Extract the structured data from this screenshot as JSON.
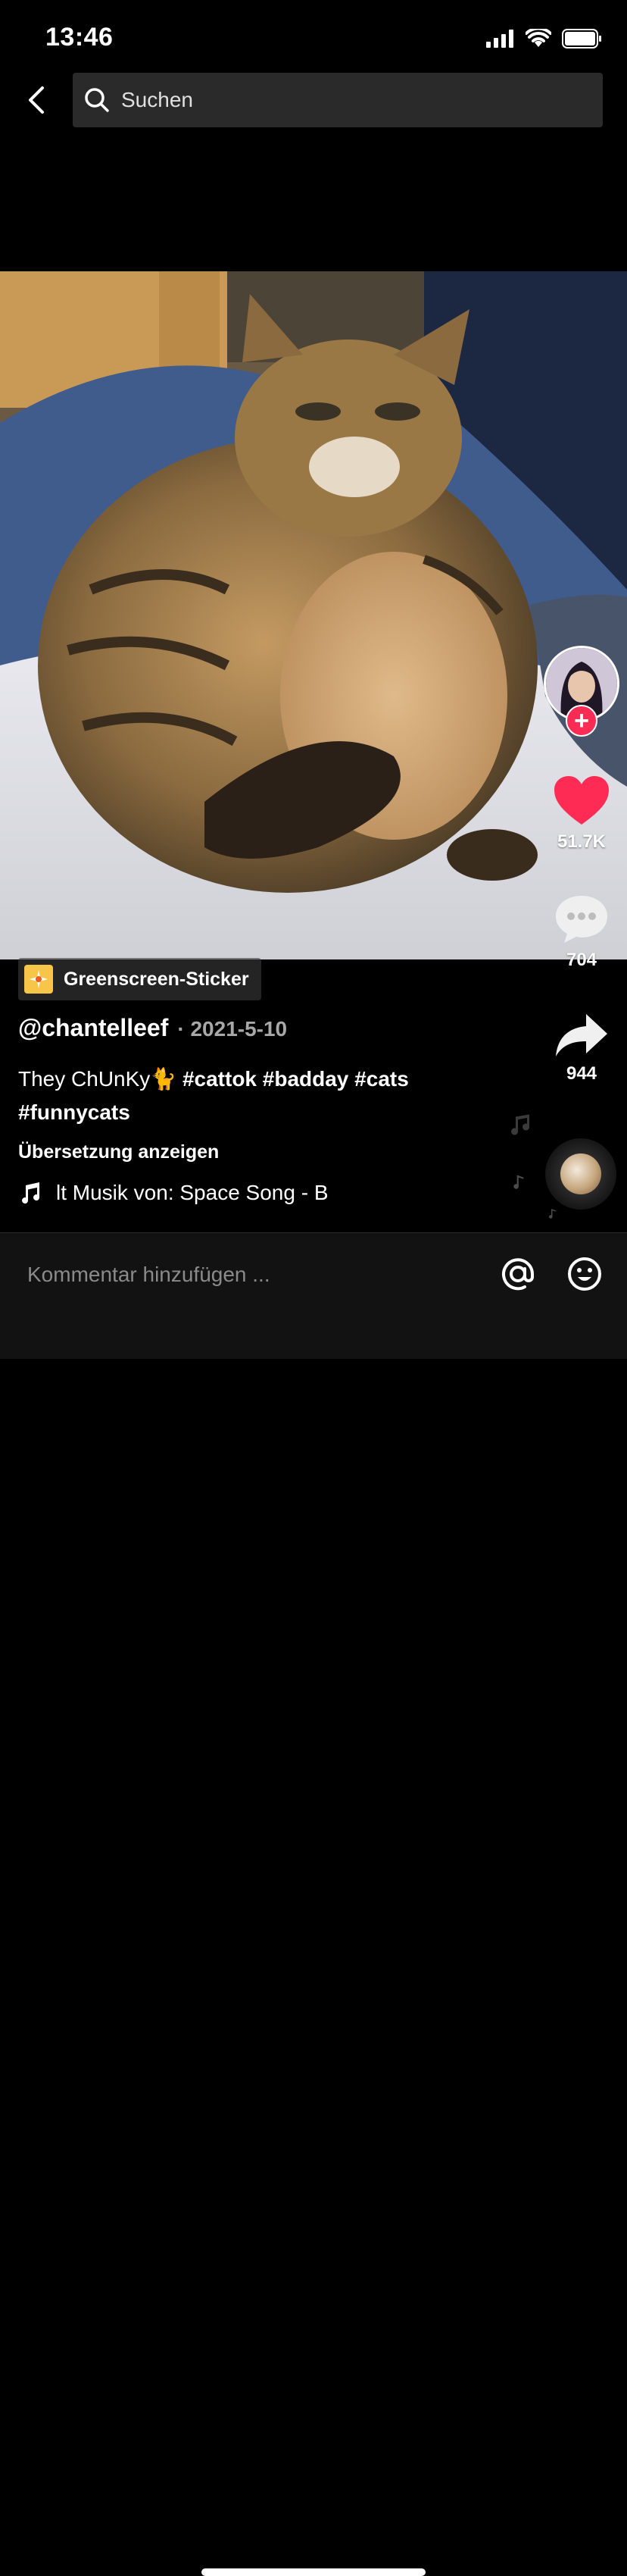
{
  "status_bar": {
    "time": "13:46"
  },
  "search": {
    "placeholder": "Suchen"
  },
  "video": {
    "subject": "tabby-cat-sitting-on-bed"
  },
  "rail": {
    "likes": "51.7K",
    "comments": "704",
    "shares": "944"
  },
  "post": {
    "sticker_label": "Greenscreen-Sticker",
    "username": "@chantelleef",
    "date": "· 2021-5-10",
    "caption_text": "They ChUnKy",
    "caption_emoji": "🐈",
    "hashtags": [
      "#cattok",
      "#badday",
      "#cats",
      "#funnycats"
    ],
    "translate_label": "Übersetzung anzeigen",
    "music": "lt Musik von: Space Song - B"
  },
  "comment_bar": {
    "placeholder": "Kommentar hinzufügen ..."
  },
  "colors": {
    "like": "#fe2c55",
    "background": "#000000",
    "sticker": "#f7c548"
  }
}
